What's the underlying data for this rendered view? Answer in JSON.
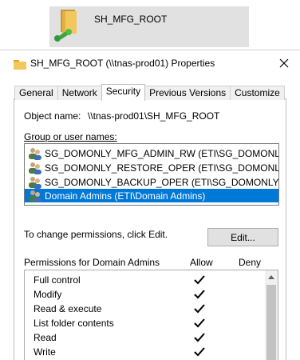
{
  "shortcut": {
    "name": "SH_MFG_ROOT",
    "icon": "shared-folder-icon"
  },
  "dialog": {
    "title": "SH_MFG_ROOT (\\\\tnas-prod01) Properties",
    "close": "✕"
  },
  "tabs": [
    {
      "label": "General"
    },
    {
      "label": "Network"
    },
    {
      "label": "Security",
      "active": true
    },
    {
      "label": "Previous Versions"
    },
    {
      "label": "Customize"
    }
  ],
  "security": {
    "object_name_label": "Object name:",
    "object_name_value": "\\\\tnas-prod01\\SH_MFG_ROOT",
    "group_label": "Group or user names:",
    "groups": [
      {
        "name": "SG_DOMONLY_MFG_ADMIN_RW (ETI\\SG_DOMONLY_..."
      },
      {
        "name": "SG_DOMONLY_RESTORE_OPER (ETI\\SG_DOMONLY_..."
      },
      {
        "name": "SG_DOMONLY_BACKUP_OPER (ETI\\SG_DOMONLY_BA..."
      },
      {
        "name": "Domain Admins (ETI\\Domain Admins)",
        "selected": true
      }
    ],
    "change_hint": "To change permissions, click Edit.",
    "edit_button": "Edit...",
    "permissions_label": "Permissions for Domain Admins",
    "allow_header": "Allow",
    "deny_header": "Deny",
    "permissions": [
      {
        "name": "Full control",
        "allow": true,
        "deny": false
      },
      {
        "name": "Modify",
        "allow": true,
        "deny": false
      },
      {
        "name": "Read & execute",
        "allow": true,
        "deny": false
      },
      {
        "name": "List folder contents",
        "allow": true,
        "deny": false
      },
      {
        "name": "Read",
        "allow": true,
        "deny": false
      },
      {
        "name": "Write",
        "allow": true,
        "deny": false
      }
    ]
  },
  "colors": {
    "selection": "#0078d7",
    "folder": "#e8b84a",
    "share_badge": "#3aa63a"
  }
}
